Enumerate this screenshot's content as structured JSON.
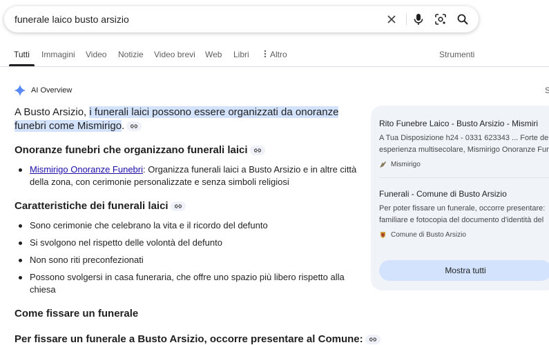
{
  "search": {
    "query": "funerale laico busto arsizio"
  },
  "icons": {
    "clear": "close-icon",
    "voice": "microphone-icon",
    "lens": "camera-lens-icon",
    "search": "search-icon",
    "more": "vertical-dots-icon",
    "ai": "sparkle-icon",
    "link": "link-icon"
  },
  "tabs": [
    {
      "label": "Tutti"
    },
    {
      "label": "Immagini"
    },
    {
      "label": "Video"
    },
    {
      "label": "Notizie"
    },
    {
      "label": "Video brevi"
    },
    {
      "label": "Web"
    },
    {
      "label": "Libri"
    },
    {
      "label": "Altro"
    }
  ],
  "tools_label": "Strumenti",
  "ai_overview": {
    "label": "AI Overview",
    "corner_letter": "S",
    "lead_prefix": "A Busto Arsizio, ",
    "lead_highlight_1": "i funerali laici possono essere organizzati da onoranze",
    "lead_highlight_2": "funebri come Mismirigo",
    "lead_suffix": ".",
    "section1": {
      "title": "Onoranze funebri che organizzano funerali laici",
      "items": [
        {
          "link": "Mismirigo Onoranze Funebri",
          "text": ": Organizza funerali laici a Busto Arsizio e in altre città della zona, con cerimonie personalizzate e senza simboli religiosi"
        }
      ]
    },
    "section2": {
      "title": "Caratteristiche dei funerali laici",
      "items": [
        "Sono cerimonie che celebrano la vita e il ricordo del defunto",
        "Si svolgono nel rispetto delle volontà del defunto",
        "Non sono riti preconfezionati",
        "Possono svolgersi in casa funeraria, che offre uno spazio più libero rispetto alla chiesa"
      ]
    },
    "section3": {
      "title": "Come fissare un funerale"
    },
    "section4": {
      "title": "Per fissare un funerale a Busto Arsizio, occorre presentare al Comune:"
    }
  },
  "sources": {
    "cards": [
      {
        "title": "Rito Funebre Laico - Busto Arsizio - Mismiri",
        "snippet_1": "A Tua Disposizione h24 - 0331 623343 ... Forte de",
        "snippet_2": "esperienza multisecolare, Mismirigo Onoranze Fun",
        "source": "Mismirigo"
      },
      {
        "title": "Funerali - Comune di Busto Arsizio",
        "snippet_1": "Per poter fissare un funerale, occorre presentare:",
        "snippet_2": "familiare e fotocopia del documento d'identità del",
        "source": "Comune di Busto Arsizio"
      }
    ],
    "show_all": "Mostra tutti"
  }
}
